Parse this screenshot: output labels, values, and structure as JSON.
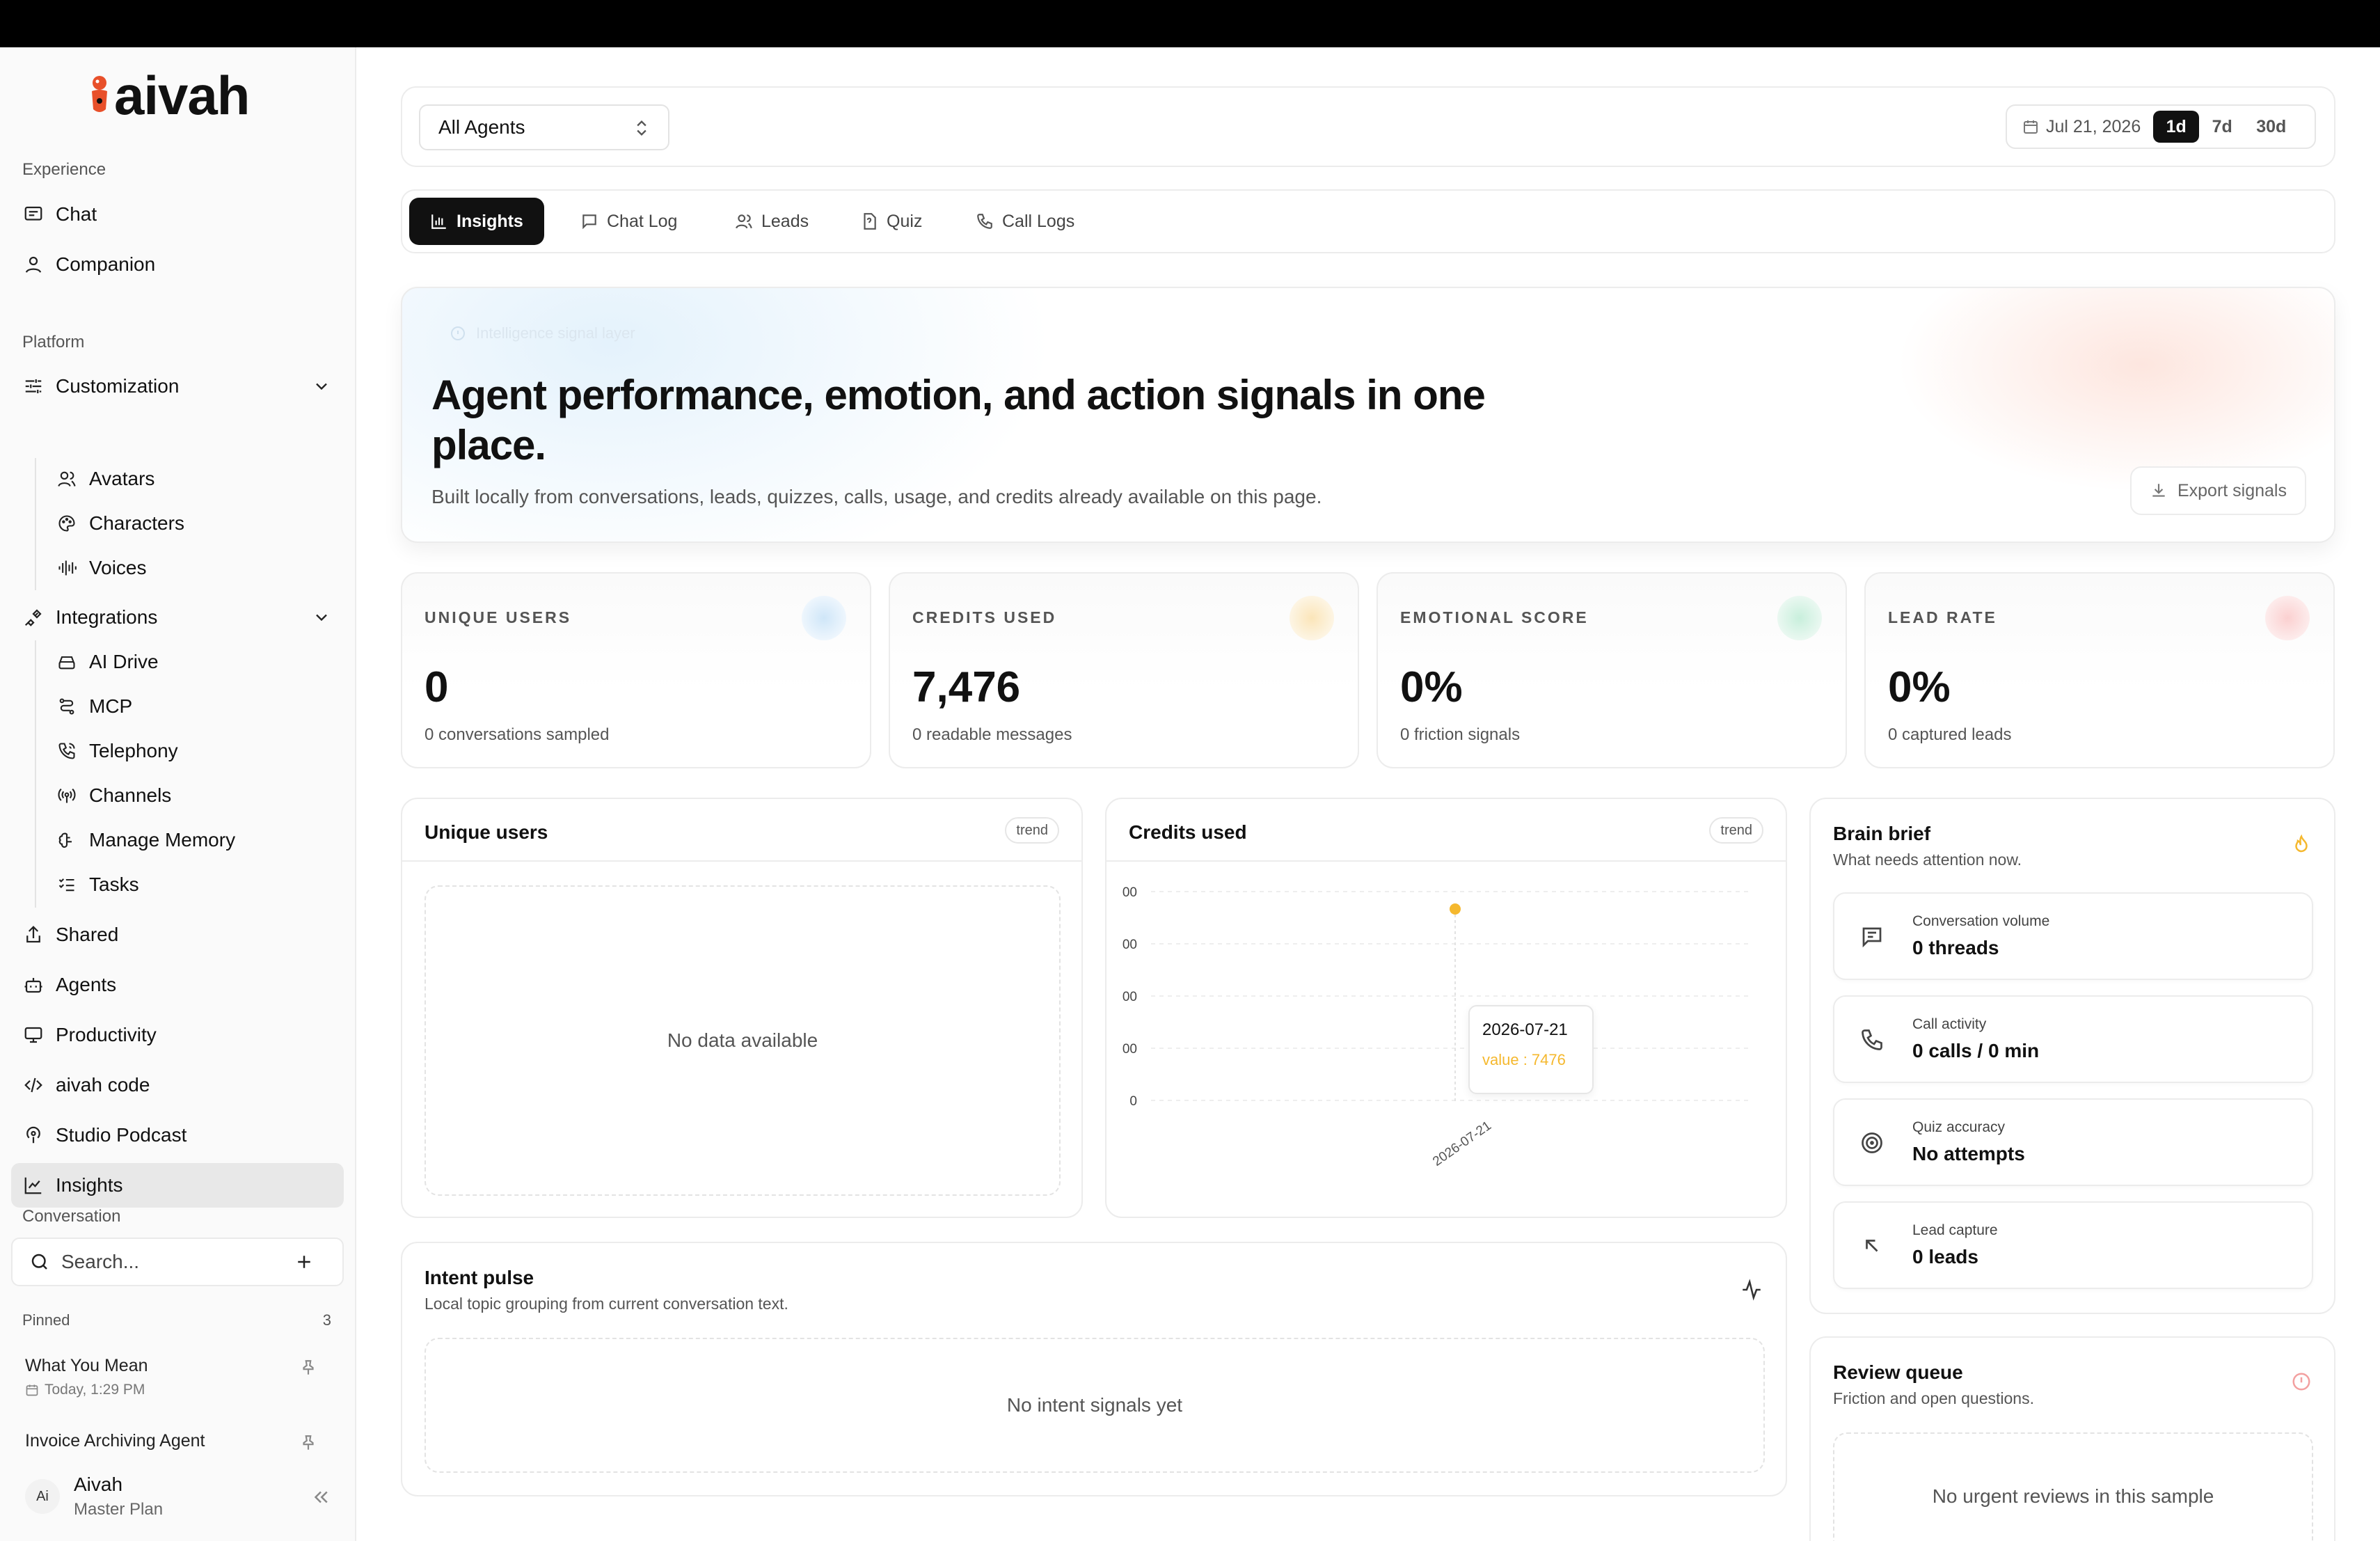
{
  "app": {
    "brand": "aivah"
  },
  "sidebar": {
    "experience_label": "Experience",
    "experience_items": [
      {
        "label": "Chat",
        "icon": "message-square-icon"
      },
      {
        "label": "Companion",
        "icon": "user-icon"
      }
    ],
    "platform_label": "Platform",
    "customization": {
      "label": "Customization",
      "children": [
        {
          "label": "Avatars",
          "icon": "users-icon"
        },
        {
          "label": "Characters",
          "icon": "palette-icon"
        },
        {
          "label": "Voices",
          "icon": "audio-lines-icon"
        }
      ]
    },
    "integrations": {
      "label": "Integrations",
      "children": [
        {
          "label": "AI Drive",
          "icon": "hard-drive-icon"
        },
        {
          "label": "MCP",
          "icon": "route-icon"
        },
        {
          "label": "Telephony",
          "icon": "phone-call-icon"
        },
        {
          "label": "Channels",
          "icon": "radio-icon"
        },
        {
          "label": "Manage Memory",
          "icon": "brain-icon"
        },
        {
          "label": "Tasks",
          "icon": "list-checks-icon"
        }
      ]
    },
    "platform_items": [
      {
        "label": "Shared",
        "icon": "share-icon"
      },
      {
        "label": "Agents",
        "icon": "bot-icon"
      },
      {
        "label": "Productivity",
        "icon": "monitor-icon"
      },
      {
        "label": "aivah code",
        "icon": "code-icon"
      },
      {
        "label": "Studio Podcast",
        "icon": "podcast-icon"
      },
      {
        "label": "Insights",
        "icon": "chart-line-icon"
      }
    ],
    "conversation_label": "Conversation",
    "search_placeholder": "Search...",
    "pinned_label": "Pinned",
    "pinned_count": "3",
    "pinned_chats": [
      {
        "title": "What You Mean",
        "time": "Today, 1:29 PM"
      },
      {
        "title": "Invoice Archiving Agent",
        "time": ""
      }
    ],
    "user": {
      "initials": "Ai",
      "name": "Aivah",
      "plan": "Master Plan"
    }
  },
  "toolbar": {
    "agent_select": "All Agents",
    "date": "Jul 21, 2026",
    "ranges": [
      "1d",
      "7d",
      "30d"
    ],
    "active_range": "1d"
  },
  "tabs": [
    {
      "label": "Insights",
      "icon": "bar-chart-icon"
    },
    {
      "label": "Chat Log",
      "icon": "message-square-icon"
    },
    {
      "label": "Leads",
      "icon": "users-icon"
    },
    {
      "label": "Quiz",
      "icon": "file-question-icon"
    },
    {
      "label": "Call Logs",
      "icon": "phone-icon"
    }
  ],
  "hero": {
    "badge": "Intelligence signal layer",
    "title": "Agent performance, emotion, and action signals in one place.",
    "description": "Built locally from conversations, leads, quizzes, calls, usage, and credits already available on this page.",
    "export_label": "Export signals"
  },
  "metrics": [
    {
      "label": "UNIQUE USERS",
      "value": "0",
      "sub": "0 conversations sampled",
      "color": "#dcecfa"
    },
    {
      "label": "CREDITS USED",
      "value": "7,476",
      "sub": "0 readable messages",
      "color": "#fdf0d5"
    },
    {
      "label": "EMOTIONAL SCORE",
      "value": "0%",
      "sub": "0 friction signals",
      "color": "#dcf5ea"
    },
    {
      "label": "LEAD RATE",
      "value": "0%",
      "sub": "0 captured leads",
      "color": "#fde1e1"
    }
  ],
  "unique_users_panel": {
    "title": "Unique users",
    "badge": "trend",
    "empty": "No data available"
  },
  "credits_panel": {
    "title": "Credits used",
    "badge": "trend",
    "tooltip_date": "2026-07-21",
    "tooltip_value": "value : 7476",
    "y_ticks": [
      "00",
      "00",
      "00",
      "00",
      "0"
    ],
    "x_tick": "2026-07-21"
  },
  "chart_data": {
    "type": "line",
    "x": [
      "2026-07-21"
    ],
    "series": [
      {
        "values": [
          7476
        ]
      }
    ],
    "title": "Credits used",
    "accent": "#f5b82e"
  },
  "intent_panel": {
    "title": "Intent pulse",
    "subtitle": "Local topic grouping from current conversation text.",
    "empty": "No intent signals yet"
  },
  "brain_brief": {
    "title": "Brain brief",
    "subtitle": "What needs attention now.",
    "items": [
      {
        "label": "Conversation volume",
        "value": "0 threads",
        "icon": "message-square-text-icon"
      },
      {
        "label": "Call activity",
        "value": "0 calls / 0 min",
        "icon": "phone-icon"
      },
      {
        "label": "Quiz accuracy",
        "value": "No attempts",
        "icon": "target-icon"
      },
      {
        "label": "Lead capture",
        "value": "0 leads",
        "icon": "arrow-up-left-icon"
      }
    ]
  },
  "review_queue": {
    "title": "Review queue",
    "subtitle": "Friction and open questions.",
    "empty": "No urgent reviews in this sample"
  }
}
